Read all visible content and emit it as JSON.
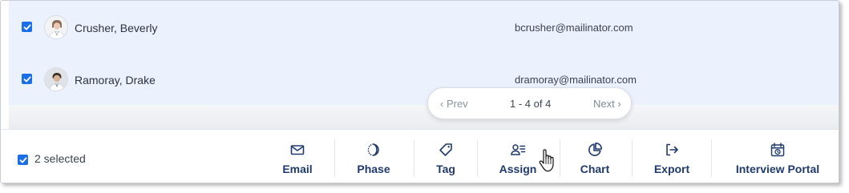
{
  "rows": [
    {
      "name": "Crusher, Beverly",
      "email": "bcrusher@mailinator.com",
      "checked": true
    },
    {
      "name": "Ramoray, Drake",
      "email": "dramoray@mailinator.com",
      "checked": true
    }
  ],
  "pagination": {
    "prev_label": "‹ Prev",
    "range_label": "1 - 4 of 4",
    "next_label": "Next ›"
  },
  "selection": {
    "count_label": "2  selected"
  },
  "actions": {
    "email": {
      "label": "Email",
      "icon": "envelope-icon"
    },
    "phase": {
      "label": "Phase",
      "icon": "moon-phase-icon"
    },
    "tag": {
      "label": "Tag",
      "icon": "tag-icon"
    },
    "assign": {
      "label": "Assign",
      "icon": "assign-user-icon"
    },
    "chart": {
      "label": "Chart",
      "icon": "pie-chart-icon"
    },
    "export": {
      "label": "Export",
      "icon": "export-arrow-icon"
    },
    "interview_portal": {
      "label": "Interview Portal",
      "icon": "calendar-clock-icon"
    }
  },
  "colors": {
    "accent": "#1a6fe8",
    "action_text": "#1f3a6e",
    "selected_row": "#ebf1fd"
  }
}
